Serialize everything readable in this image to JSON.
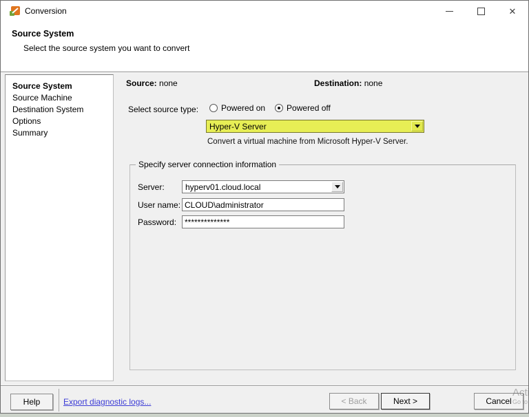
{
  "window": {
    "title": "Conversion",
    "close_glyph": "✕"
  },
  "header": {
    "title": "Source System",
    "subtitle": "Select the source system you want to convert"
  },
  "sidebar": {
    "items": [
      {
        "label": "Source System",
        "active": true
      },
      {
        "label": "Source Machine",
        "active": false
      },
      {
        "label": "Destination System",
        "active": false
      },
      {
        "label": "Options",
        "active": false
      },
      {
        "label": "Summary",
        "active": false
      }
    ]
  },
  "main": {
    "source_label": "Source:",
    "source_value": "none",
    "destination_label": "Destination:",
    "destination_value": "none",
    "source_type": {
      "label": "Select source type:",
      "options": [
        {
          "label": "Powered on",
          "selected": false
        },
        {
          "label": "Powered off",
          "selected": true
        }
      ]
    },
    "source_dropdown": {
      "value": "Hyper-V Server",
      "highlight_color": "#e7ee55"
    },
    "description": "Convert a virtual machine from Microsoft Hyper-V Server.",
    "server_group": {
      "legend": "Specify server connection information",
      "fields": [
        {
          "label": "Server:",
          "value": "hyperv01.cloud.local",
          "type": "combo"
        },
        {
          "label": "User name:",
          "value": "CLOUD\\administrator",
          "type": "text"
        },
        {
          "label": "Password:",
          "value": "**************",
          "type": "password"
        }
      ]
    }
  },
  "footer": {
    "help_label": "Help",
    "export_link": "Export diagnostic logs...",
    "back_label": "< Back",
    "next_label": "Next >",
    "cancel_label": "Cancel"
  },
  "watermark": {
    "line1": "Activate Windows",
    "line2": "Go to Settings to activate Windows."
  },
  "colors": {
    "link": "#3b3bd6",
    "dropdown_highlight": "#e7ee55"
  }
}
